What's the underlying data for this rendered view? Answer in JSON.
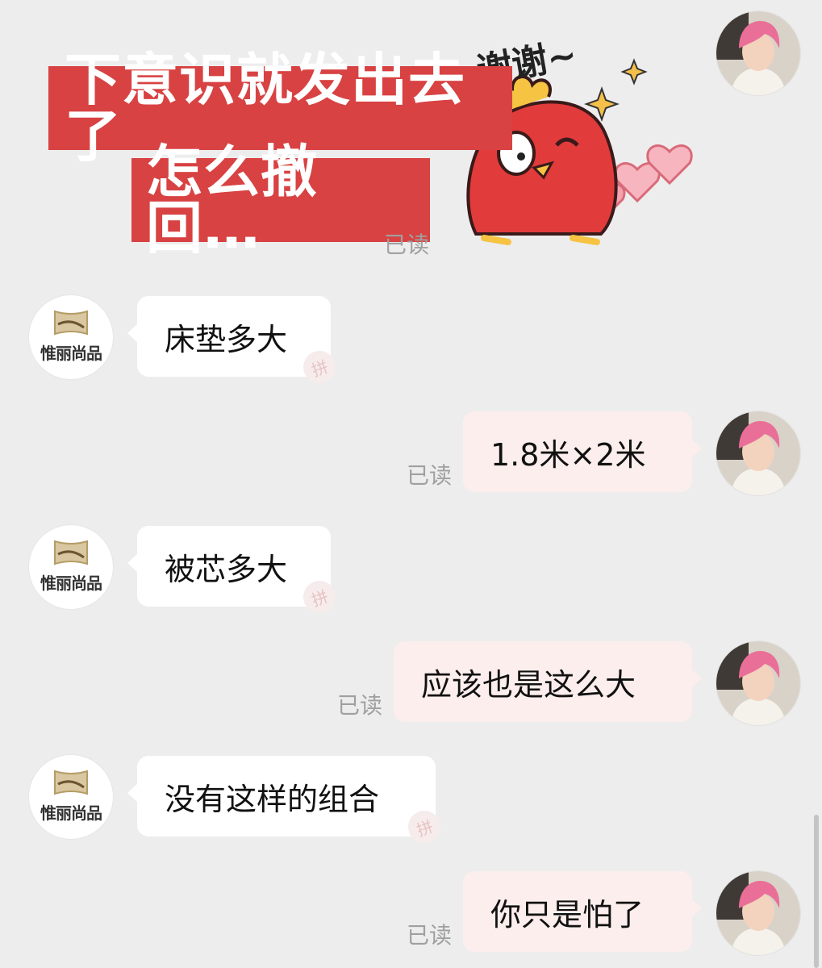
{
  "overlay": {
    "caption_line1": "下意识就发出去了",
    "caption_line2": "怎么撤回…",
    "sticker_text": "谢谢~",
    "caption_color": "#d84242"
  },
  "shop": {
    "name": "惟丽尚品"
  },
  "messages": [
    {
      "from": "user",
      "text": "",
      "status": "已读",
      "kind": "sticker"
    },
    {
      "from": "shop",
      "text": "床垫多大"
    },
    {
      "from": "user",
      "text": "1.8米×2米",
      "status": "已读"
    },
    {
      "from": "shop",
      "text": "被芯多大"
    },
    {
      "from": "user",
      "text": "应该也是这么大",
      "status": "已读"
    },
    {
      "from": "shop",
      "text": "没有这样的组合"
    },
    {
      "from": "user",
      "text": "你只是怕了",
      "status": "已读"
    }
  ],
  "icons": {
    "shop_badge": "拼",
    "user_avatar": "pink-haired-avatar-icon",
    "shop_logo": "pillow-logo-icon"
  }
}
